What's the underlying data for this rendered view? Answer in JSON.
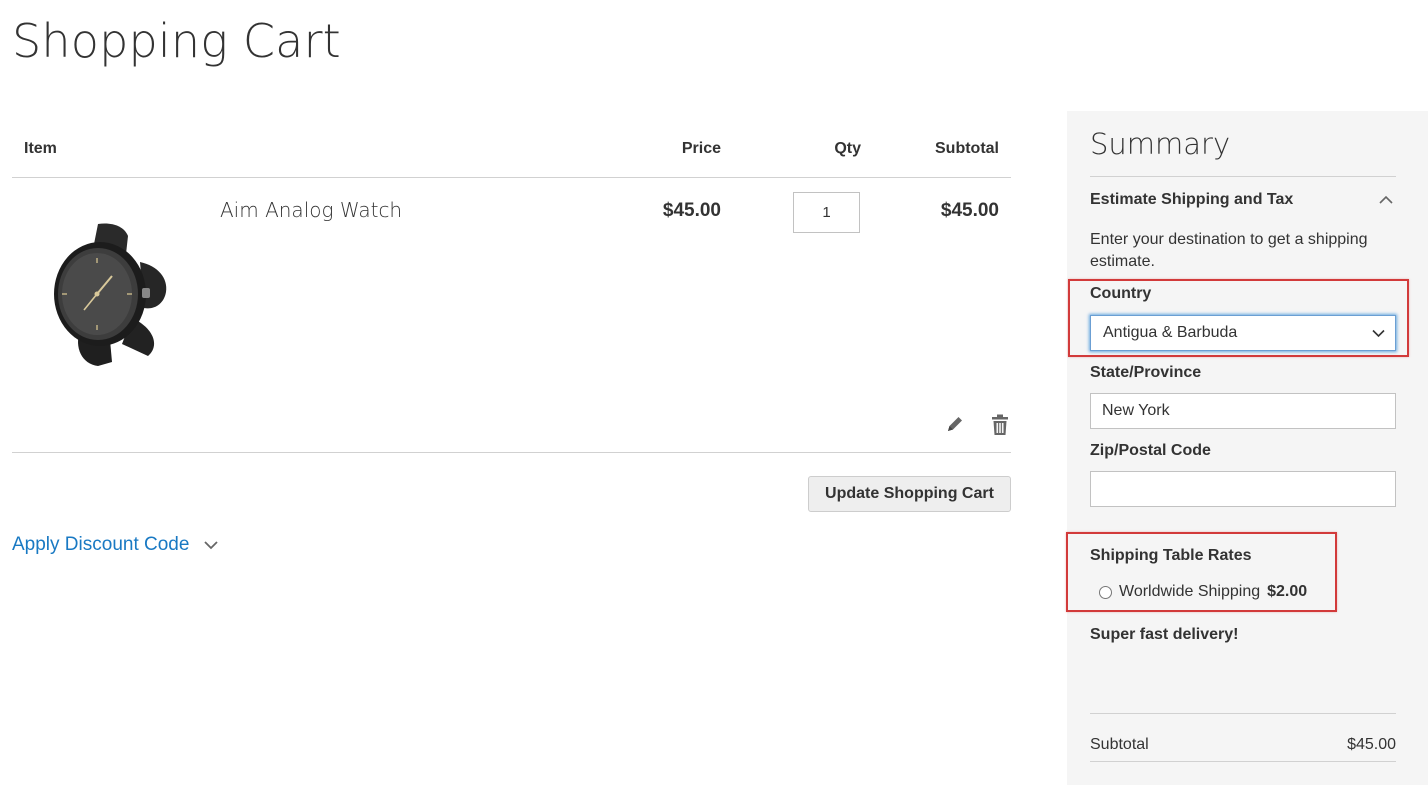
{
  "page": {
    "title": "Shopping Cart"
  },
  "cart": {
    "columns": {
      "item": "Item",
      "price": "Price",
      "qty": "Qty",
      "subtotal": "Subtotal"
    },
    "items": [
      {
        "name": "Aim Analog Watch",
        "price": "$45.00",
        "qty": "1",
        "subtotal": "$45.00",
        "image_icon": "watch-image"
      }
    ],
    "update_label": "Update Shopping Cart",
    "discount_label": "Apply Discount Code"
  },
  "summary": {
    "title": "Summary",
    "shipping_title": "Estimate Shipping and Tax",
    "shipping_desc": "Enter your destination to get a shipping estimate.",
    "country_label": "Country",
    "country_value": "Antigua & Barbuda",
    "state_label": "State/Province",
    "state_value": "New York",
    "zip_label": "Zip/Postal Code",
    "zip_value": "",
    "rates_title": "Shipping Table Rates",
    "rate_name": "Worldwide Shipping",
    "rate_price": "$2.00",
    "rate_desc": "Super fast delivery!",
    "totals": [
      {
        "label": "Subtotal",
        "value": "$45.00"
      }
    ]
  },
  "colors": {
    "link": "#1979c3",
    "highlight": "#d23a3a",
    "summary_bg": "#f5f5f5"
  }
}
